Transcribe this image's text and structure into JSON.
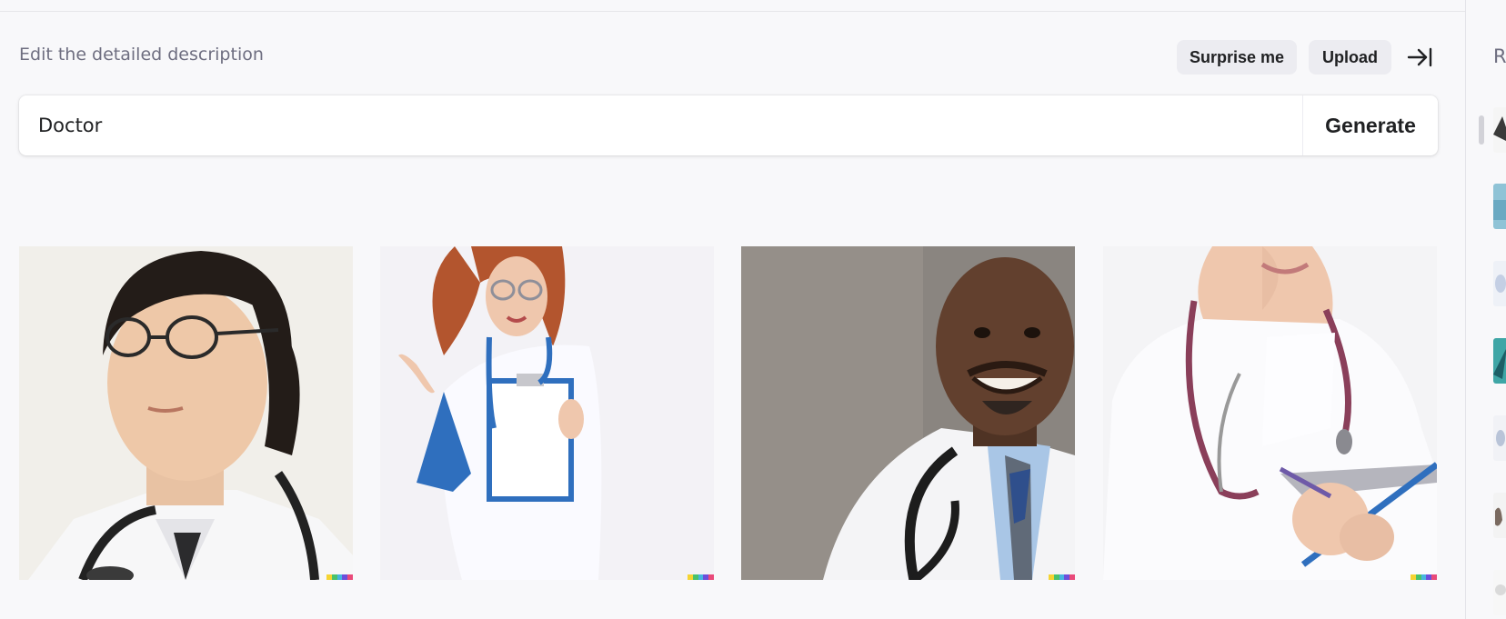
{
  "editor": {
    "description_label": "Edit the detailed description",
    "surprise_label": "Surprise me",
    "upload_label": "Upload",
    "prompt_value": "Doctor",
    "generate_label": "Generate"
  },
  "results": [
    {
      "name": "generated-image-1",
      "subject": "young man with glasses in white coat with stethoscope"
    },
    {
      "name": "generated-image-2",
      "subject": "woman in white coat holding clipboard pointing"
    },
    {
      "name": "generated-image-3",
      "subject": "smiling man in white coat with tie and stethoscope"
    },
    {
      "name": "generated-image-4",
      "subject": "woman in white coat with stethoscope holding clipboard"
    }
  ],
  "sidebar": {
    "heading": "Recent"
  },
  "colors": {
    "signature": [
      "#f5d432",
      "#4ac26b",
      "#47b4e0",
      "#6b4fdb",
      "#e94a7a"
    ]
  }
}
